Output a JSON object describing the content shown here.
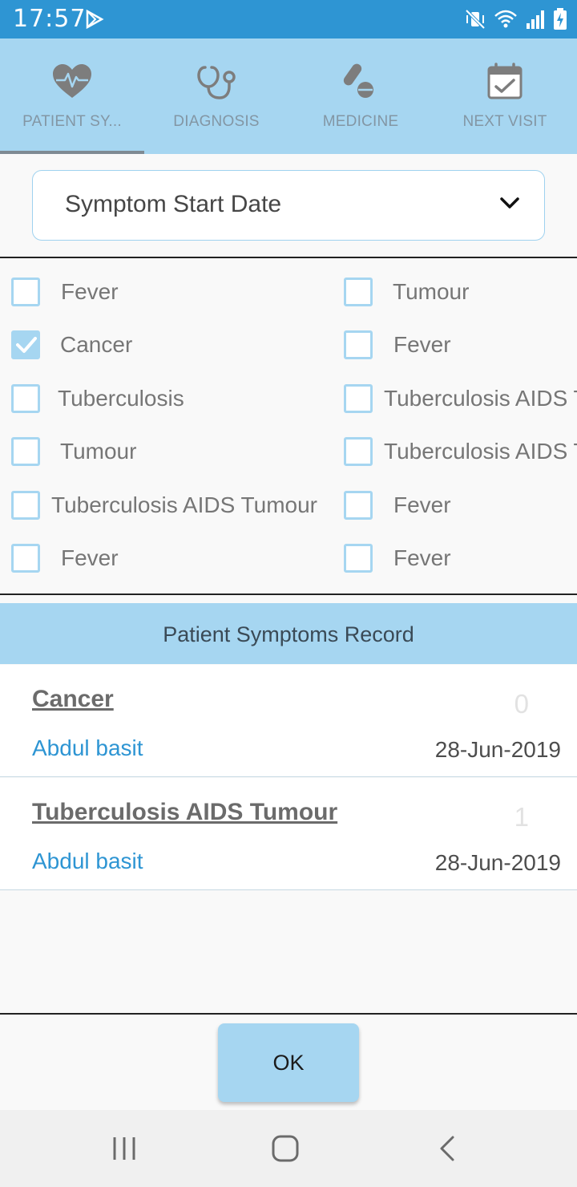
{
  "status": {
    "time": "17:57",
    "icons": [
      "play-store-icon",
      "mute-vibrate-icon",
      "wifi-icon",
      "signal-icon",
      "battery-charging-icon"
    ]
  },
  "tabs": [
    {
      "label": "PATIENT SY...",
      "icon": "heart-pulse-icon",
      "selected": true
    },
    {
      "label": "DIAGNOSIS",
      "icon": "stethoscope-icon",
      "selected": false
    },
    {
      "label": "MEDICINE",
      "icon": "pills-icon",
      "selected": false
    },
    {
      "label": "NEXT VISIT",
      "icon": "calendar-check-icon",
      "selected": false
    }
  ],
  "dropdown": {
    "label": "Symptom Start Date"
  },
  "symptoms": {
    "left": [
      {
        "label": "Fever",
        "checked": false
      },
      {
        "label": "Cancer",
        "checked": true
      },
      {
        "label": "Tuberculosis",
        "checked": false
      },
      {
        "label": "Tumour",
        "checked": false
      },
      {
        "label": "Tuberculosis AIDS Tumour",
        "checked": false
      },
      {
        "label": "Fever",
        "checked": false
      }
    ],
    "right": [
      {
        "label": "Tumour",
        "checked": false
      },
      {
        "label": "Fever",
        "checked": false
      },
      {
        "label": "Tuberculosis AIDS T",
        "checked": false
      },
      {
        "label": "Tuberculosis AIDS T",
        "checked": false
      },
      {
        "label": "Fever",
        "checked": false
      },
      {
        "label": "Fever",
        "checked": false
      }
    ]
  },
  "records": {
    "title": "Patient Symptoms Record",
    "items": [
      {
        "name": "Cancer",
        "number": "0",
        "user": "Abdul basit",
        "date": "28-Jun-2019"
      },
      {
        "name": "Tuberculosis AIDS Tumour",
        "number": "1",
        "user": "Abdul basit",
        "date": "28-Jun-2019"
      }
    ]
  },
  "ok_button": {
    "label": "OK"
  },
  "colors": {
    "status_bar": "#2e95d3",
    "accent_light": "#a6d6f1",
    "link": "#2e95d3"
  }
}
